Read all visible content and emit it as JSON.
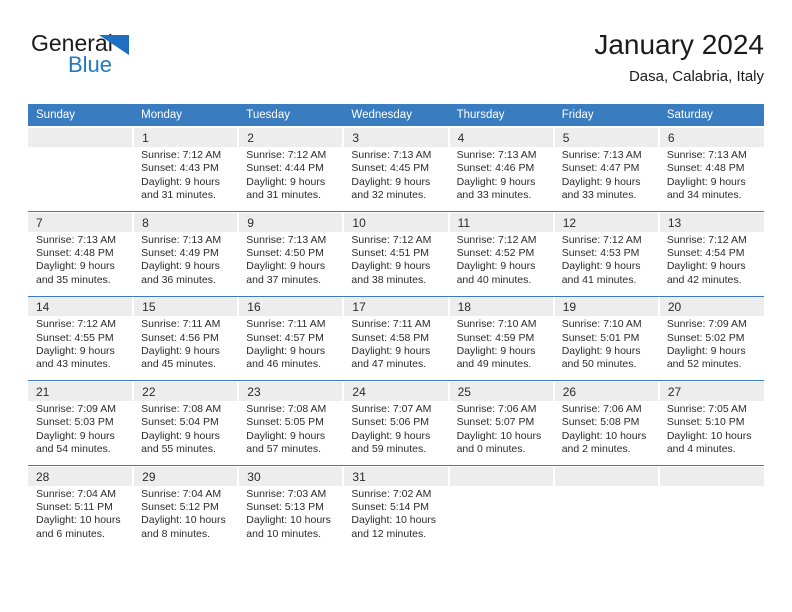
{
  "brand": {
    "word1": "General",
    "word2": "Blue",
    "triangle_color": "#1f6fc0",
    "blue_color": "#1f7ac4"
  },
  "header": {
    "title": "January 2024",
    "location": "Dasa, Calabria, Italy"
  },
  "theme": {
    "header_blue": "#3a7cc0",
    "daynum_band": "#ededed",
    "text": "#2b2b2b"
  },
  "weekday_headers": [
    "Sunday",
    "Monday",
    "Tuesday",
    "Wednesday",
    "Thursday",
    "Friday",
    "Saturday"
  ],
  "weeks": [
    {
      "days": [
        {
          "num": "",
          "sunrise": "",
          "sunset": "",
          "daylight_1": "",
          "daylight_2": ""
        },
        {
          "num": "1",
          "sunrise": "Sunrise: 7:12 AM",
          "sunset": "Sunset: 4:43 PM",
          "daylight_1": "Daylight: 9 hours",
          "daylight_2": "and 31 minutes."
        },
        {
          "num": "2",
          "sunrise": "Sunrise: 7:12 AM",
          "sunset": "Sunset: 4:44 PM",
          "daylight_1": "Daylight: 9 hours",
          "daylight_2": "and 31 minutes."
        },
        {
          "num": "3",
          "sunrise": "Sunrise: 7:13 AM",
          "sunset": "Sunset: 4:45 PM",
          "daylight_1": "Daylight: 9 hours",
          "daylight_2": "and 32 minutes."
        },
        {
          "num": "4",
          "sunrise": "Sunrise: 7:13 AM",
          "sunset": "Sunset: 4:46 PM",
          "daylight_1": "Daylight: 9 hours",
          "daylight_2": "and 33 minutes."
        },
        {
          "num": "5",
          "sunrise": "Sunrise: 7:13 AM",
          "sunset": "Sunset: 4:47 PM",
          "daylight_1": "Daylight: 9 hours",
          "daylight_2": "and 33 minutes."
        },
        {
          "num": "6",
          "sunrise": "Sunrise: 7:13 AM",
          "sunset": "Sunset: 4:48 PM",
          "daylight_1": "Daylight: 9 hours",
          "daylight_2": "and 34 minutes."
        }
      ]
    },
    {
      "days": [
        {
          "num": "7",
          "sunrise": "Sunrise: 7:13 AM",
          "sunset": "Sunset: 4:48 PM",
          "daylight_1": "Daylight: 9 hours",
          "daylight_2": "and 35 minutes."
        },
        {
          "num": "8",
          "sunrise": "Sunrise: 7:13 AM",
          "sunset": "Sunset: 4:49 PM",
          "daylight_1": "Daylight: 9 hours",
          "daylight_2": "and 36 minutes."
        },
        {
          "num": "9",
          "sunrise": "Sunrise: 7:13 AM",
          "sunset": "Sunset: 4:50 PM",
          "daylight_1": "Daylight: 9 hours",
          "daylight_2": "and 37 minutes."
        },
        {
          "num": "10",
          "sunrise": "Sunrise: 7:12 AM",
          "sunset": "Sunset: 4:51 PM",
          "daylight_1": "Daylight: 9 hours",
          "daylight_2": "and 38 minutes."
        },
        {
          "num": "11",
          "sunrise": "Sunrise: 7:12 AM",
          "sunset": "Sunset: 4:52 PM",
          "daylight_1": "Daylight: 9 hours",
          "daylight_2": "and 40 minutes."
        },
        {
          "num": "12",
          "sunrise": "Sunrise: 7:12 AM",
          "sunset": "Sunset: 4:53 PM",
          "daylight_1": "Daylight: 9 hours",
          "daylight_2": "and 41 minutes."
        },
        {
          "num": "13",
          "sunrise": "Sunrise: 7:12 AM",
          "sunset": "Sunset: 4:54 PM",
          "daylight_1": "Daylight: 9 hours",
          "daylight_2": "and 42 minutes."
        }
      ]
    },
    {
      "days": [
        {
          "num": "14",
          "sunrise": "Sunrise: 7:12 AM",
          "sunset": "Sunset: 4:55 PM",
          "daylight_1": "Daylight: 9 hours",
          "daylight_2": "and 43 minutes."
        },
        {
          "num": "15",
          "sunrise": "Sunrise: 7:11 AM",
          "sunset": "Sunset: 4:56 PM",
          "daylight_1": "Daylight: 9 hours",
          "daylight_2": "and 45 minutes."
        },
        {
          "num": "16",
          "sunrise": "Sunrise: 7:11 AM",
          "sunset": "Sunset: 4:57 PM",
          "daylight_1": "Daylight: 9 hours",
          "daylight_2": "and 46 minutes."
        },
        {
          "num": "17",
          "sunrise": "Sunrise: 7:11 AM",
          "sunset": "Sunset: 4:58 PM",
          "daylight_1": "Daylight: 9 hours",
          "daylight_2": "and 47 minutes."
        },
        {
          "num": "18",
          "sunrise": "Sunrise: 7:10 AM",
          "sunset": "Sunset: 4:59 PM",
          "daylight_1": "Daylight: 9 hours",
          "daylight_2": "and 49 minutes."
        },
        {
          "num": "19",
          "sunrise": "Sunrise: 7:10 AM",
          "sunset": "Sunset: 5:01 PM",
          "daylight_1": "Daylight: 9 hours",
          "daylight_2": "and 50 minutes."
        },
        {
          "num": "20",
          "sunrise": "Sunrise: 7:09 AM",
          "sunset": "Sunset: 5:02 PM",
          "daylight_1": "Daylight: 9 hours",
          "daylight_2": "and 52 minutes."
        }
      ]
    },
    {
      "days": [
        {
          "num": "21",
          "sunrise": "Sunrise: 7:09 AM",
          "sunset": "Sunset: 5:03 PM",
          "daylight_1": "Daylight: 9 hours",
          "daylight_2": "and 54 minutes."
        },
        {
          "num": "22",
          "sunrise": "Sunrise: 7:08 AM",
          "sunset": "Sunset: 5:04 PM",
          "daylight_1": "Daylight: 9 hours",
          "daylight_2": "and 55 minutes."
        },
        {
          "num": "23",
          "sunrise": "Sunrise: 7:08 AM",
          "sunset": "Sunset: 5:05 PM",
          "daylight_1": "Daylight: 9 hours",
          "daylight_2": "and 57 minutes."
        },
        {
          "num": "24",
          "sunrise": "Sunrise: 7:07 AM",
          "sunset": "Sunset: 5:06 PM",
          "daylight_1": "Daylight: 9 hours",
          "daylight_2": "and 59 minutes."
        },
        {
          "num": "25",
          "sunrise": "Sunrise: 7:06 AM",
          "sunset": "Sunset: 5:07 PM",
          "daylight_1": "Daylight: 10 hours",
          "daylight_2": "and 0 minutes."
        },
        {
          "num": "26",
          "sunrise": "Sunrise: 7:06 AM",
          "sunset": "Sunset: 5:08 PM",
          "daylight_1": "Daylight: 10 hours",
          "daylight_2": "and 2 minutes."
        },
        {
          "num": "27",
          "sunrise": "Sunrise: 7:05 AM",
          "sunset": "Sunset: 5:10 PM",
          "daylight_1": "Daylight: 10 hours",
          "daylight_2": "and 4 minutes."
        }
      ]
    },
    {
      "days": [
        {
          "num": "28",
          "sunrise": "Sunrise: 7:04 AM",
          "sunset": "Sunset: 5:11 PM",
          "daylight_1": "Daylight: 10 hours",
          "daylight_2": "and 6 minutes."
        },
        {
          "num": "29",
          "sunrise": "Sunrise: 7:04 AM",
          "sunset": "Sunset: 5:12 PM",
          "daylight_1": "Daylight: 10 hours",
          "daylight_2": "and 8 minutes."
        },
        {
          "num": "30",
          "sunrise": "Sunrise: 7:03 AM",
          "sunset": "Sunset: 5:13 PM",
          "daylight_1": "Daylight: 10 hours",
          "daylight_2": "and 10 minutes."
        },
        {
          "num": "31",
          "sunrise": "Sunrise: 7:02 AM",
          "sunset": "Sunset: 5:14 PM",
          "daylight_1": "Daylight: 10 hours",
          "daylight_2": "and 12 minutes."
        },
        {
          "num": "",
          "sunrise": "",
          "sunset": "",
          "daylight_1": "",
          "daylight_2": ""
        },
        {
          "num": "",
          "sunrise": "",
          "sunset": "",
          "daylight_1": "",
          "daylight_2": ""
        },
        {
          "num": "",
          "sunrise": "",
          "sunset": "",
          "daylight_1": "",
          "daylight_2": ""
        }
      ]
    }
  ]
}
